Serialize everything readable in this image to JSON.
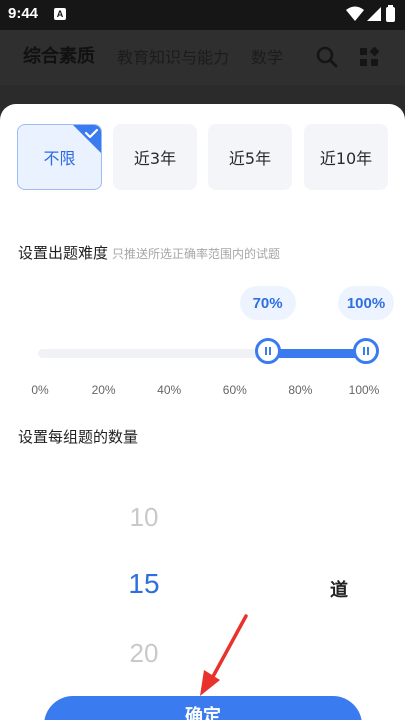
{
  "status_bar": {
    "time": "9:44",
    "notification_glyph": "A"
  },
  "nav": {
    "tabs": [
      {
        "label": "综合素质"
      },
      {
        "label": "教育知识与能力"
      },
      {
        "label": "数学"
      }
    ]
  },
  "year_options": [
    {
      "label": "不限",
      "selected": true
    },
    {
      "label": "近3年",
      "selected": false
    },
    {
      "label": "近5年",
      "selected": false
    },
    {
      "label": "近10年",
      "selected": false
    }
  ],
  "difficulty": {
    "title": "设置出题难度",
    "hint": "只推送所选正确率范围内的试题",
    "range_low": 70,
    "range_high": 100,
    "low_label": "70%",
    "high_label": "100%",
    "ticks": [
      "0%",
      "20%",
      "40%",
      "60%",
      "80%",
      "100%"
    ]
  },
  "count": {
    "title": "设置每组题的数量",
    "options": [
      "10",
      "15",
      "20"
    ],
    "selected": "15",
    "unit": "道"
  },
  "confirm_label": "确定",
  "colors": {
    "accent": "#3a7cf0",
    "annotation_arrow": "#e8322b"
  }
}
